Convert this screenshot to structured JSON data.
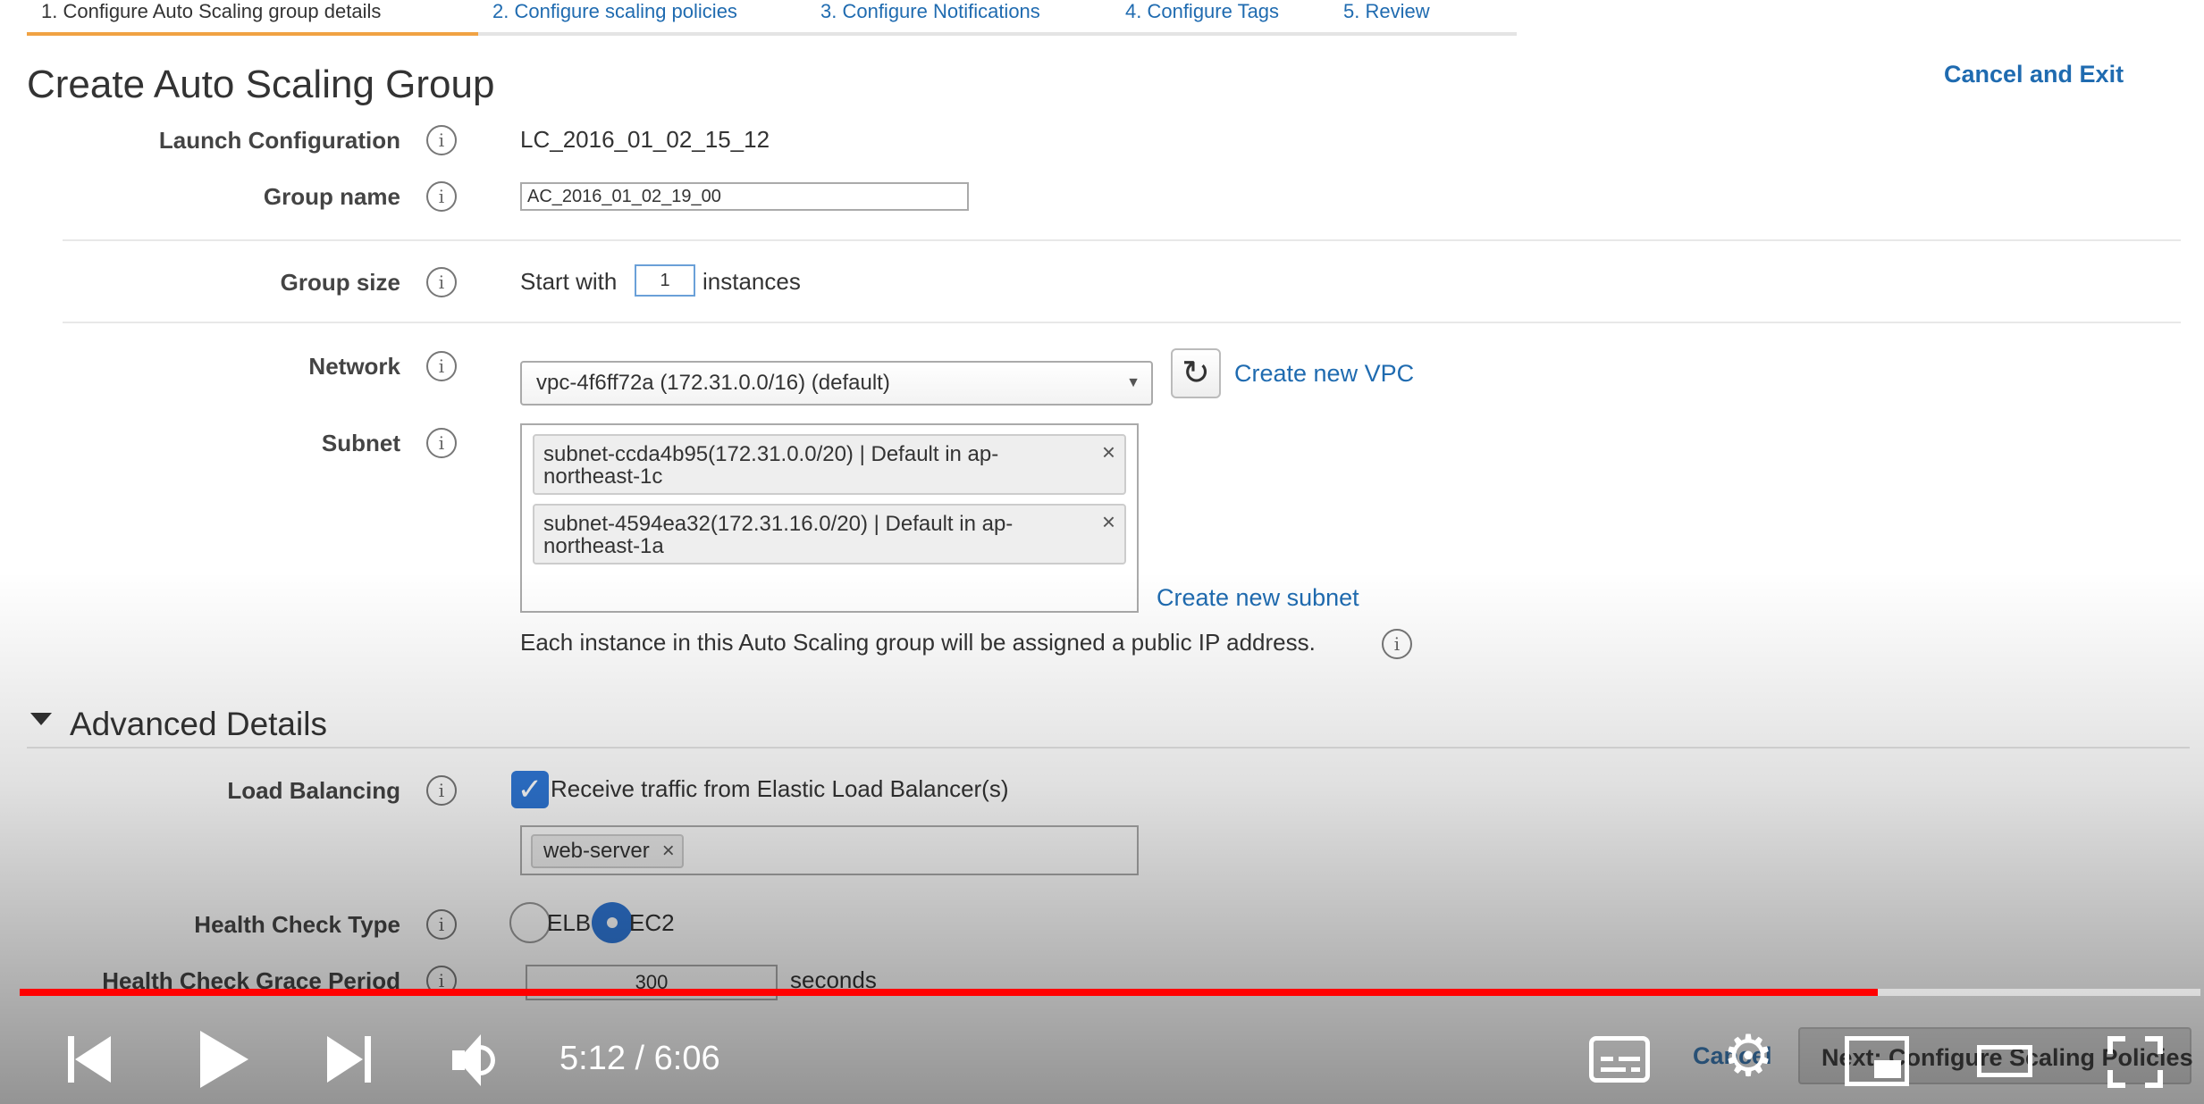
{
  "tabs": [
    {
      "label": "1. Configure Auto Scaling group details"
    },
    {
      "label": "2. Configure scaling policies"
    },
    {
      "label": "3. Configure Notifications"
    },
    {
      "label": "4. Configure Tags"
    },
    {
      "label": "5. Review"
    }
  ],
  "page_title": "Create Auto Scaling Group",
  "cancel_and_exit": "Cancel and Exit",
  "form": {
    "launch_config": {
      "label": "Launch Configuration",
      "value": "LC_2016_01_02_15_12"
    },
    "group_name": {
      "label": "Group name",
      "value": "AC_2016_01_02_19_00"
    },
    "group_size": {
      "label": "Group size",
      "prefix": "Start with",
      "value": "1",
      "suffix": "instances"
    },
    "network": {
      "label": "Network",
      "value": "vpc-4f6ff72a (172.31.0.0/16) (default)",
      "create_link": "Create new VPC"
    },
    "subnet": {
      "label": "Subnet",
      "items": [
        "subnet-ccda4b95(172.31.0.0/20) | Default in ap-northeast-1c",
        "subnet-4594ea32(172.31.16.0/20) | Default in ap-northeast-1a"
      ],
      "create_link": "Create new subnet",
      "public_ip_note": "Each instance in this Auto Scaling group will be assigned a public IP address."
    }
  },
  "advanced": {
    "title": "Advanced Details",
    "load_balancing": {
      "label": "Load Balancing",
      "checkbox_label": "Receive traffic from Elastic Load Balancer(s)",
      "checked": true,
      "chip": "web-server"
    },
    "health_check_type": {
      "label": "Health Check Type",
      "options": [
        "ELB",
        "EC2"
      ],
      "selected": "EC2"
    },
    "grace_period": {
      "label": "Health Check Grace Period",
      "value": "300",
      "unit": "seconds"
    }
  },
  "bottom_buttons": {
    "cancel": "Cancel",
    "next": "Next: Configure Scaling Policies"
  },
  "player": {
    "time": "5:12 / 6:06",
    "progress_fraction": 0.852,
    "progress_color": "#ff0000"
  },
  "icons": [
    "info-icon",
    "refresh-icon",
    "chevron-down-icon",
    "close-icon",
    "checkmark-icon",
    "skip-previous-icon",
    "play-icon",
    "skip-next-icon",
    "volume-icon",
    "captions-icon",
    "settings-icon",
    "miniplayer-icon",
    "theater-mode-icon",
    "fullscreen-icon"
  ]
}
